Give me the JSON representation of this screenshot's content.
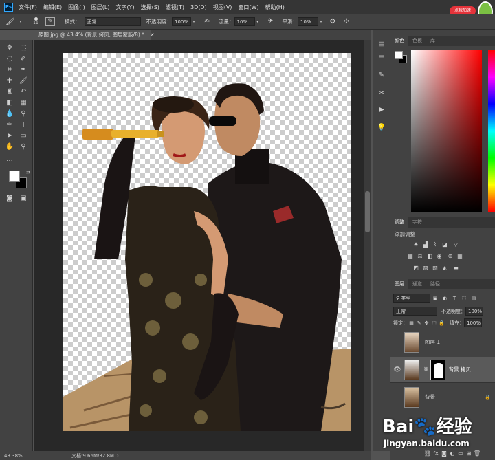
{
  "menubar": {
    "logo": "Ps",
    "items": [
      "文件(F)",
      "编辑(E)",
      "图像(I)",
      "图层(L)",
      "文字(Y)",
      "选择(S)",
      "滤镜(T)",
      "3D(D)",
      "视图(V)",
      "窗口(W)",
      "帮助(H)"
    ],
    "badge": "点我加速"
  },
  "options": {
    "brush_size": "11",
    "mode_label": "模式：",
    "mode_value": "正常",
    "opacity_label": "不透明度：",
    "opacity_value": "100%",
    "flow_label": "流量：",
    "flow_value": "10%",
    "smooth_label": "平滑：",
    "smooth_value": "10%"
  },
  "document": {
    "tab_title": "原图.jpg @ 43.4% (背景 拷贝, 图层蒙版/8) *",
    "close": "×"
  },
  "status": {
    "zoom": "43.38%",
    "doc_info": "文档:9.66M/32.8M"
  },
  "color_panel": {
    "tabs": [
      "颜色",
      "色板",
      "库"
    ],
    "accent_hue": "#ff0000"
  },
  "adjust_panel": {
    "tabs": [
      "调整",
      "字符"
    ],
    "title": "添加调整"
  },
  "layers_panel": {
    "tabs": [
      "图层",
      "通道",
      "路径"
    ],
    "kind_filter": "类型",
    "blend_mode": "正常",
    "opacity_label": "不透明度：",
    "opacity_value": "100%",
    "lock_label": "锁定：",
    "fill_label": "填充：",
    "fill_value": "100%",
    "layers": [
      {
        "name": "图层 1",
        "visible": false,
        "has_mask": false,
        "selected": false,
        "locked": false
      },
      {
        "name": "背景 拷贝",
        "visible": true,
        "has_mask": true,
        "selected": true,
        "locked": false
      },
      {
        "name": "背景",
        "visible": false,
        "has_mask": false,
        "selected": false,
        "locked": true
      }
    ]
  },
  "watermark": {
    "brand": "Bai",
    "brand2": "经验",
    "url": "jingyan.baidu.com"
  }
}
